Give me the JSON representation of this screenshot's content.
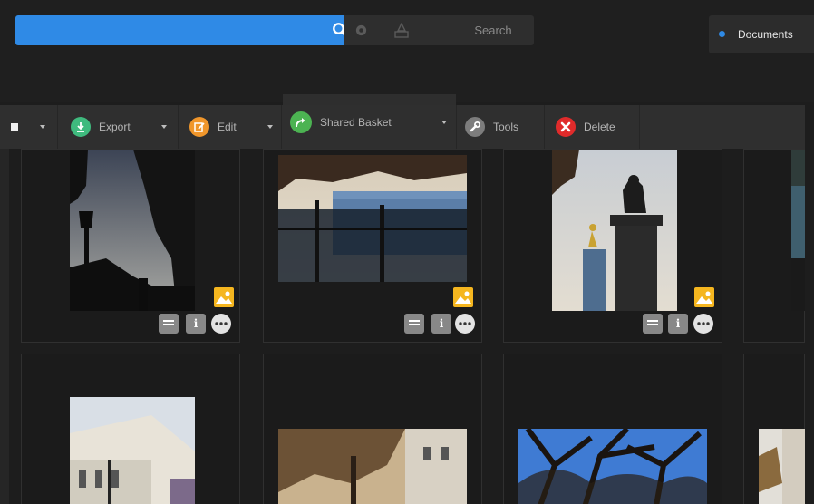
{
  "search": {
    "placeholder": "",
    "button_label": "Search"
  },
  "documents_tab": {
    "label": "Documents"
  },
  "toolbar": {
    "export_label": "Export",
    "edit_label": "Edit",
    "shared_basket_label": "Shared Basket",
    "tools_label": "Tools",
    "delete_label": "Delete"
  },
  "colors": {
    "accent": "#2f8ae6",
    "export": "#3fba7e",
    "edit": "#f0962b",
    "basket": "#4cb352",
    "delete": "#e02b2b"
  },
  "tiles": [
    {
      "subject": "lamp post silhouette against sky",
      "type_icon": "image-type-icon"
    },
    {
      "subject": "palace behind gates with autumn trees",
      "type_icon": "image-type-icon"
    },
    {
      "subject": "memorial statue with golden figure",
      "type_icon": "image-type-icon"
    },
    {
      "subject": "white stucco building with lamp",
      "type_icon": ""
    },
    {
      "subject": "autumn trees and street buildings",
      "type_icon": ""
    },
    {
      "subject": "bare trees against blue sky",
      "type_icon": ""
    }
  ]
}
